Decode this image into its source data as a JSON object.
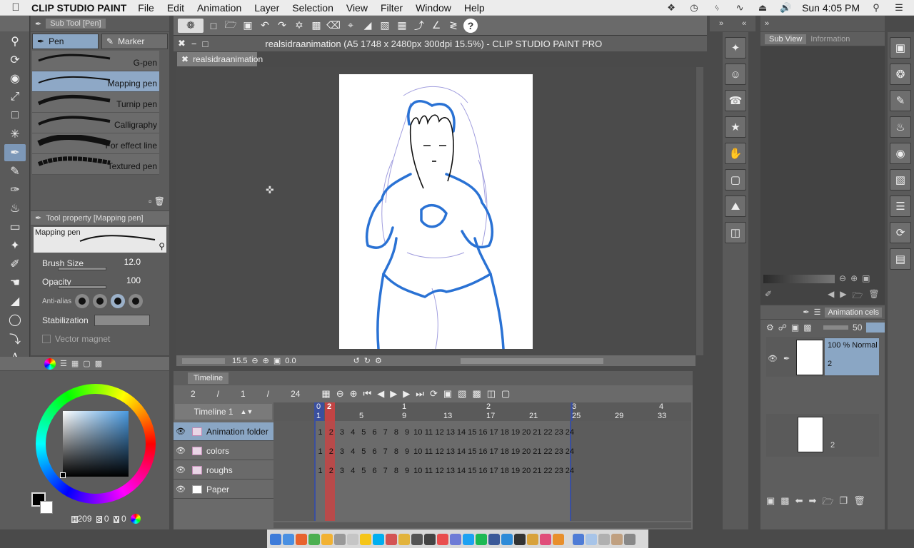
{
  "menubar": {
    "app_name": "CLIP STUDIO PAINT",
    "menus": [
      "File",
      "Edit",
      "Animation",
      "Layer",
      "Selection",
      "View",
      "Filter",
      "Window",
      "Help"
    ],
    "clock": "Sun 4:05 PM"
  },
  "subtool": {
    "title": "Sub Tool [Pen]",
    "tabs": [
      "Pen",
      "Marker"
    ],
    "brushes": [
      "G-pen",
      "Mapping pen",
      "Turnip pen",
      "Calligraphy",
      "For effect line",
      "Textured pen"
    ]
  },
  "toolprop": {
    "title": "Tool property [Mapping pen]",
    "preview_label": "Mapping pen",
    "brush_size_label": "Brush Size",
    "brush_size": "12.0",
    "opacity_label": "Opacity",
    "opacity": "100",
    "antialias_label": "Anti-alias",
    "stabilization_label": "Stabilization",
    "vector_magnet_label": "Vector magnet"
  },
  "color": {
    "hsv": {
      "h_label": "H",
      "h": "209",
      "s_label": "S",
      "s": "0",
      "v_label": "V",
      "v": "0"
    }
  },
  "document": {
    "window_title": "realsidraanimation (A5 1748 x 2480px 300dpi 15.5%)  - CLIP STUDIO PAINT PRO",
    "tab_name": "realsidraanimation",
    "zoom": "15.5",
    "rotation": "0.0"
  },
  "timeline": {
    "tab": "Timeline",
    "current_frame": "2",
    "sep": "/",
    "page": "1",
    "total_frames": "24",
    "name": "Timeline 1",
    "ruler": [
      "1",
      "5",
      "9",
      "13",
      "17",
      "21",
      "25",
      "29",
      "33"
    ],
    "ruler_top": [
      "0",
      "1",
      "2",
      "3",
      "4"
    ],
    "playhead_label": "2",
    "frame_numbers": [
      "1",
      "2",
      "3",
      "4",
      "5",
      "6",
      "7",
      "8",
      "9",
      "10",
      "11",
      "12",
      "13",
      "14",
      "15",
      "16",
      "17",
      "18",
      "19",
      "20",
      "21",
      "22",
      "23",
      "24"
    ],
    "layers": [
      {
        "name": "Animation folder",
        "active": true
      },
      {
        "name": "colors",
        "active": false
      },
      {
        "name": "roughs",
        "active": false
      },
      {
        "name": "Paper",
        "active": false
      }
    ]
  },
  "subview": {
    "tabs": [
      "Sub View",
      "Information"
    ]
  },
  "layers_panel": {
    "tab": "Animation cels",
    "opacity": "50",
    "cels": [
      {
        "blend": "100 % Normal",
        "name": "2"
      },
      {
        "blend": "",
        "name": "2"
      }
    ]
  }
}
